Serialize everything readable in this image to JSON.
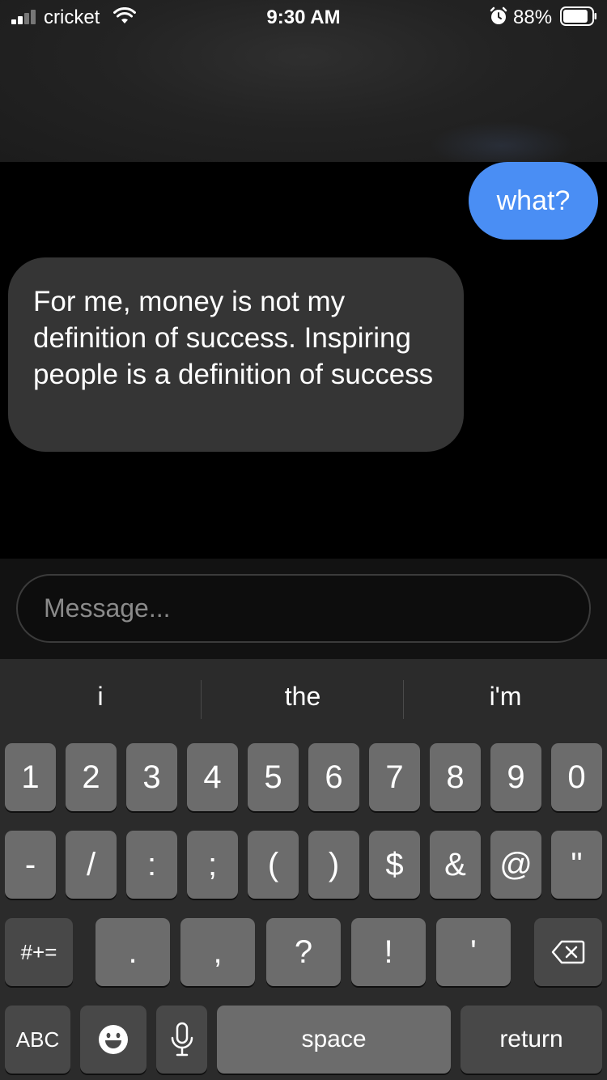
{
  "status": {
    "carrier": "cricket",
    "time": "9:30 AM",
    "battery_percent": "88%",
    "battery_level": 0.88,
    "icons": [
      "signal-icon",
      "wifi-icon",
      "alarm-icon",
      "battery-icon"
    ]
  },
  "messages": [
    {
      "direction": "outgoing",
      "text": "what?"
    },
    {
      "direction": "incoming",
      "text": "For me, money is not my definition of success. Inspiring people is a definition of success"
    }
  ],
  "composer": {
    "placeholder": "Message..."
  },
  "keyboard": {
    "suggestions": [
      "i",
      "the",
      "i'm"
    ],
    "row1": [
      "1",
      "2",
      "3",
      "4",
      "5",
      "6",
      "7",
      "8",
      "9",
      "0"
    ],
    "row2": [
      "-",
      "/",
      ":",
      ";",
      "(",
      ")",
      "$",
      "&",
      "@",
      "\""
    ],
    "row3": {
      "shift_label": "#+=",
      "keys": [
        ".",
        ",",
        "?",
        "!",
        "'"
      ],
      "delete_icon": "backspace-icon"
    },
    "row4": {
      "abc_label": "ABC",
      "emoji_icon": "emoji-icon",
      "mic_icon": "microphone-icon",
      "space_label": "space",
      "return_label": "return"
    }
  },
  "colors": {
    "outgoing_bubble": "#4a8ef4",
    "incoming_bubble": "#353535",
    "keyboard_bg": "#2b2b2b",
    "key": "#6c6c6c",
    "key_dark": "#484848"
  }
}
